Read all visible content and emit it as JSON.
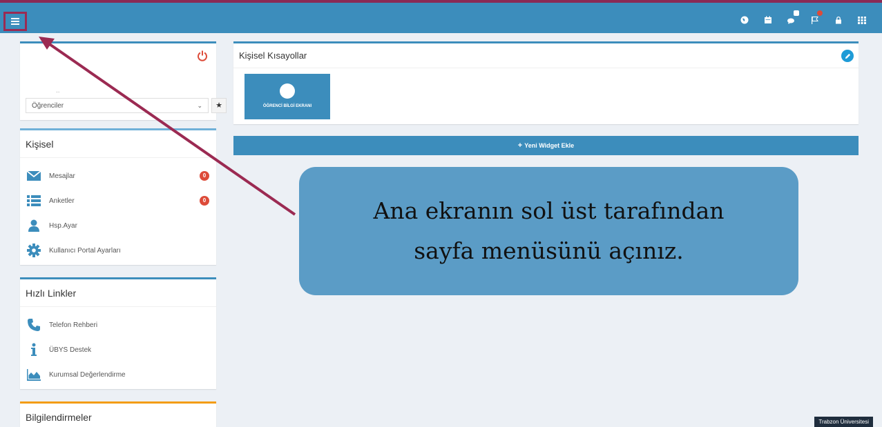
{
  "topbar": {
    "menu_toggle": "hamburger-menu-icon",
    "icons": [
      {
        "name": "globe-icon"
      },
      {
        "name": "calendar-icon"
      },
      {
        "name": "chat-icon",
        "badge": true
      },
      {
        "name": "flag-icon",
        "badge": true
      },
      {
        "name": "lock-icon"
      },
      {
        "name": "grid-icon"
      }
    ]
  },
  "user_panel": {
    "dots": "..",
    "role_select": "Öğrenciler"
  },
  "personal": {
    "title": "Kişisel",
    "items": [
      {
        "label": "Mesajlar",
        "icon": "envelope-icon",
        "count": "0"
      },
      {
        "label": "Anketler",
        "icon": "list-icon",
        "count": "0"
      },
      {
        "label": "Hsp.Ayar",
        "icon": "user-icon"
      },
      {
        "label": "Kullanıcı Portal Ayarları",
        "icon": "gear-icon"
      }
    ]
  },
  "quick_links": {
    "title": "Hızlı Linkler",
    "items": [
      {
        "label": "Telefon Rehberi",
        "icon": "phone-icon"
      },
      {
        "label": "ÜBYS Destek",
        "icon": "info-icon"
      },
      {
        "label": "Kurumsal Değerlendirme",
        "icon": "area-chart-icon"
      }
    ]
  },
  "notifications": {
    "title": "Bilgilendirmeler"
  },
  "shortcuts": {
    "title": "Kişisel Kısayollar",
    "tile_label": "ÖĞRENCİ BİLGİ EKRANI"
  },
  "widget_button": {
    "label": "Yeni Widget Ekle"
  },
  "callout": {
    "line1": "Ana ekranın sol üst tarafından",
    "line2": "sayfa menüsünü açınız."
  },
  "footer": {
    "badge": "Trabzon Üniversitesi"
  },
  "colors": {
    "accent": "#3c8dbc",
    "highlight": "#9b2a52",
    "badge_red": "#dd4b39",
    "callout": "#5b9cc6"
  }
}
